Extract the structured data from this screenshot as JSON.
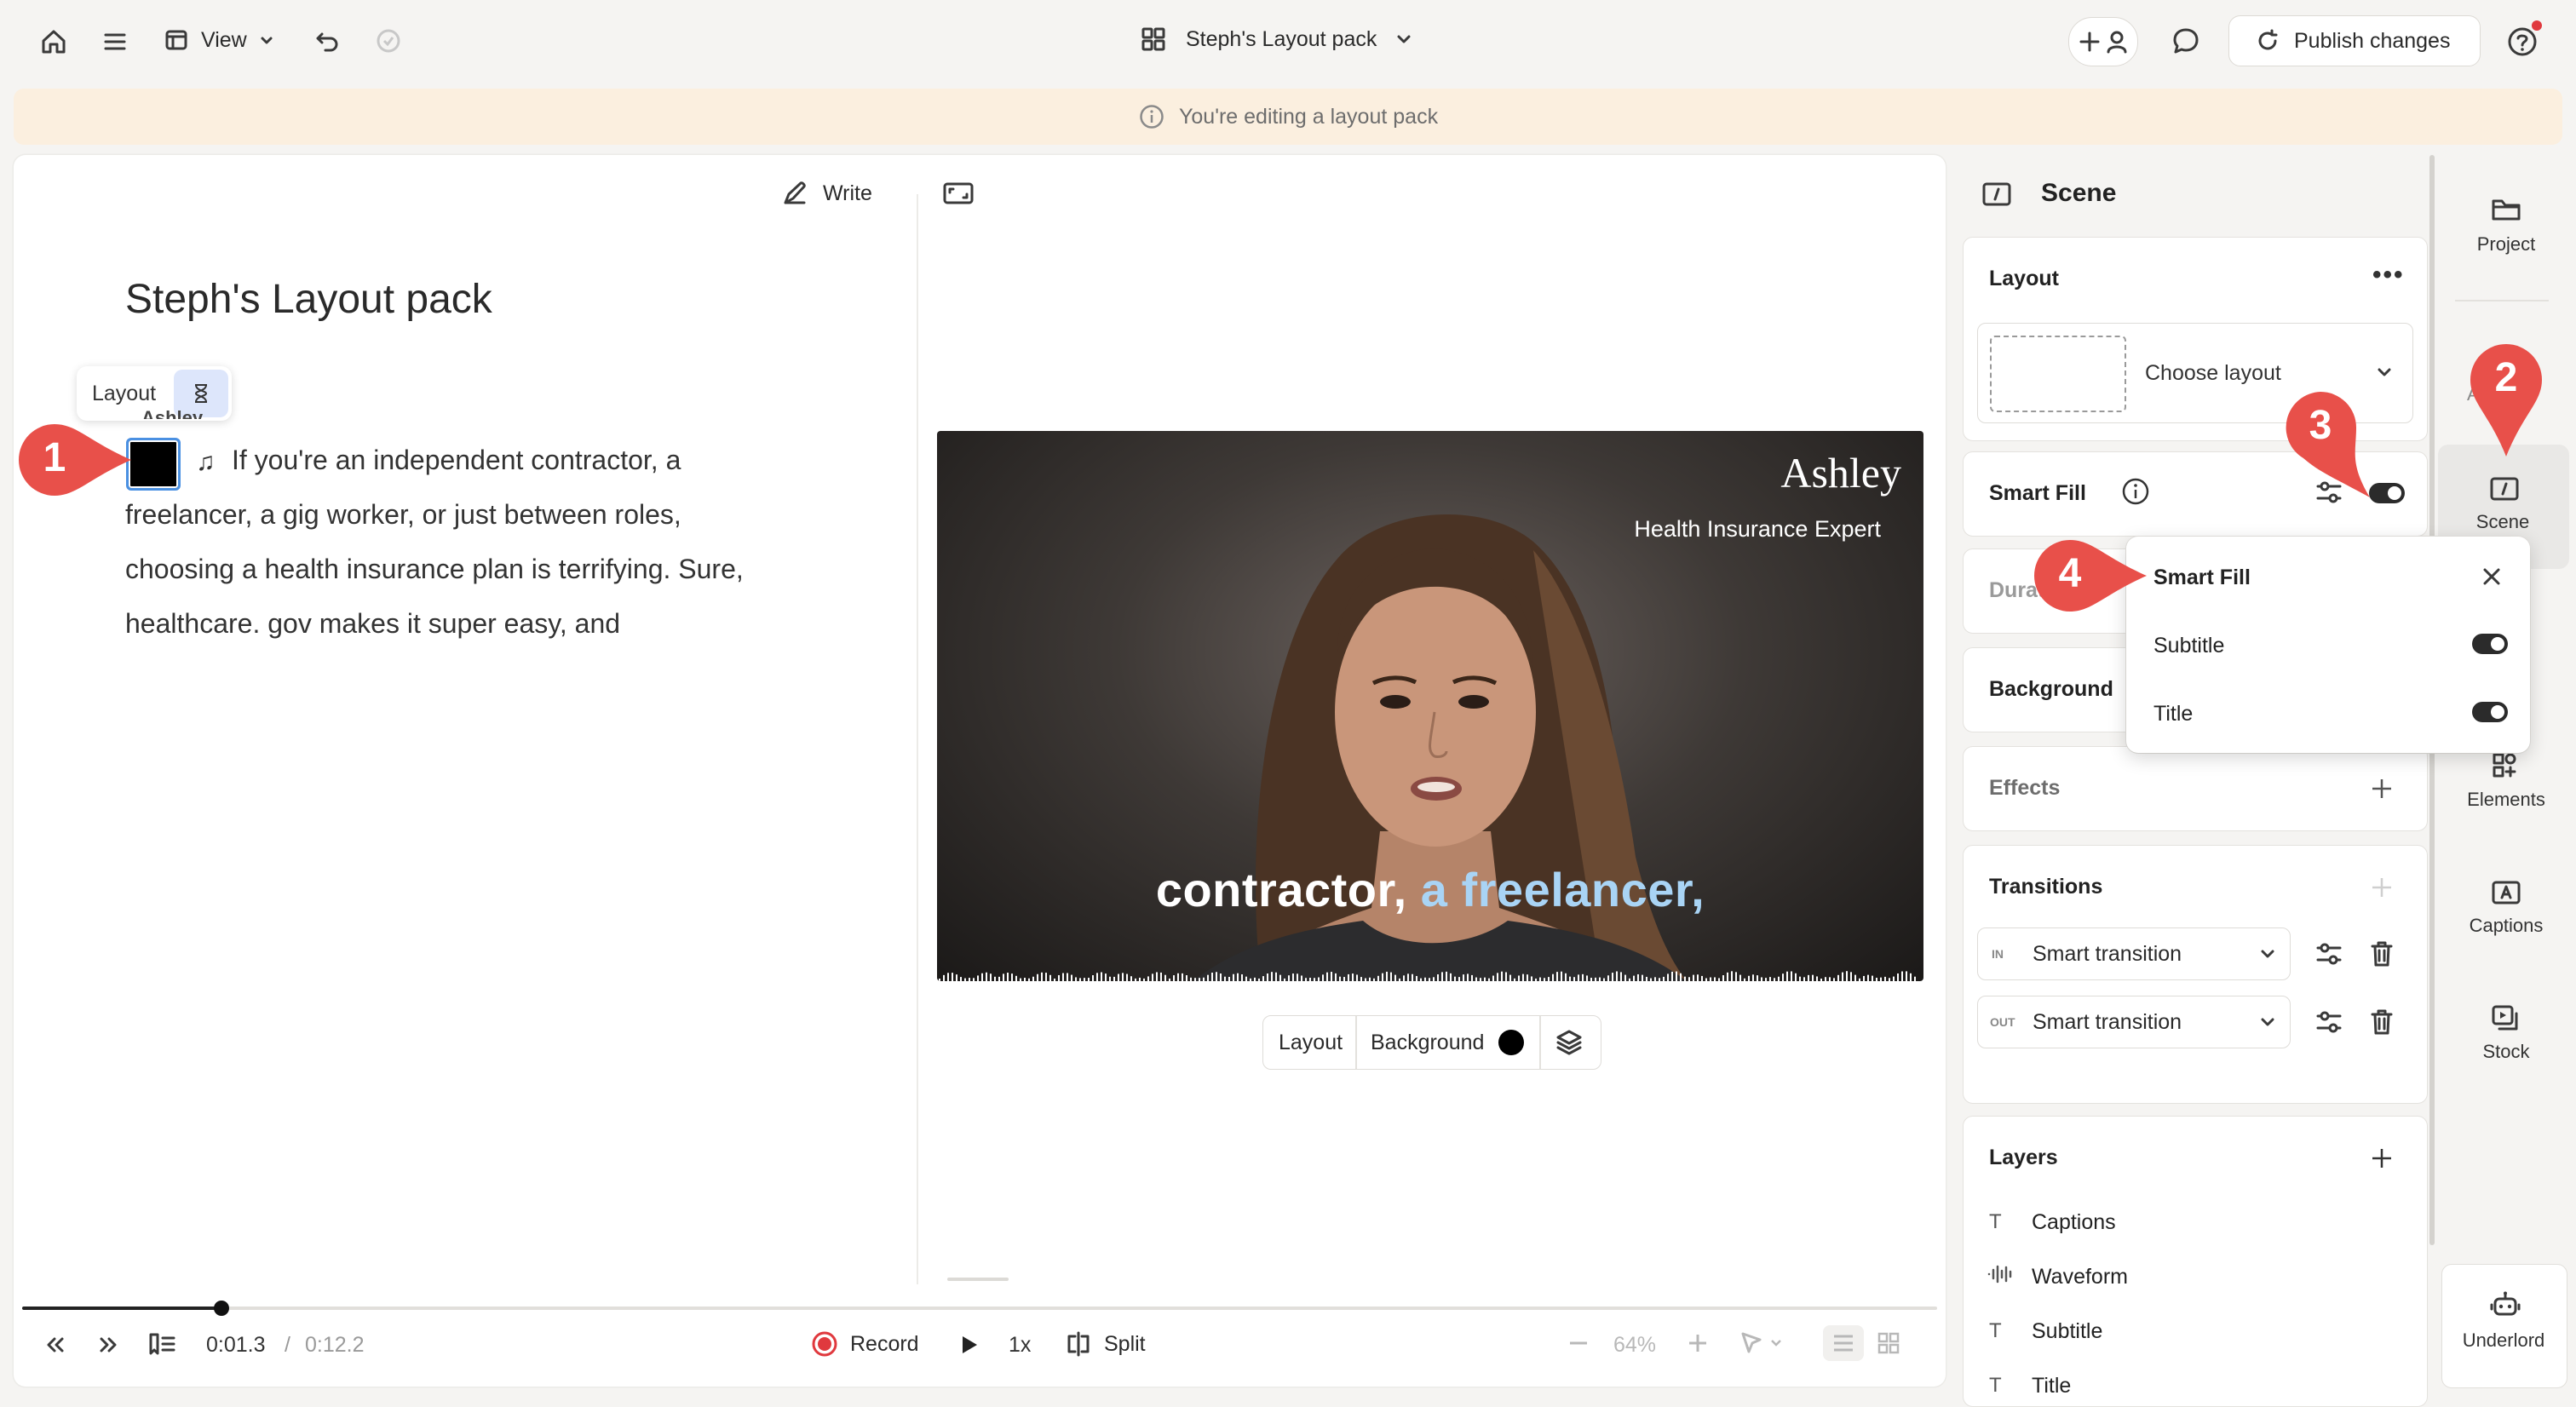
{
  "topbar": {
    "view_label": "View",
    "project_title": "Steph's Layout pack",
    "publish_label": "Publish changes"
  },
  "banner": {
    "text": "You're editing a layout pack"
  },
  "editor": {
    "write_label": "Write",
    "doc_title": "Steph's Layout pack",
    "layout_chip": "Layout",
    "speaker": "Ashley",
    "script_lines": [
      "If you're an independent contractor, a",
      "freelancer, a gig worker, or just between roles,",
      "choosing a health insurance plan is terrifying. Sure,",
      "healthcare. gov makes it super easy, and"
    ]
  },
  "preview": {
    "name": "Ashley",
    "role": "Health Insurance Expert",
    "caption_plain": "contractor,",
    "caption_highlight": "a freelancer,",
    "toolbar_layout": "Layout",
    "toolbar_background": "Background"
  },
  "transport": {
    "time_current": "0:01.3",
    "time_sep": "/",
    "time_total": "0:12.2",
    "record_label": "Record",
    "speed": "1x",
    "split_label": "Split",
    "zoom": "64%",
    "progress": 0.104
  },
  "inspector": {
    "title": "Scene",
    "layout_title": "Layout",
    "choose_layout": "Choose layout",
    "smart_fill": "Smart Fill",
    "duration_partial": "Durat",
    "background": "Background",
    "effects": "Effects",
    "transitions": "Transitions",
    "transition_in_tag": "IN",
    "transition_out_tag": "OUT",
    "transition_in": "Smart transition",
    "transition_out": "Smart transition",
    "layers_title": "Layers",
    "layers": [
      "Captions",
      "Waveform",
      "Subtitle",
      "Title"
    ]
  },
  "popover": {
    "title": "Smart Fill",
    "items": [
      {
        "label": "Subtitle",
        "on": true
      },
      {
        "label": "Title",
        "on": true
      }
    ]
  },
  "rail": {
    "items": [
      "Project",
      "Scene",
      "Elements",
      "Captions",
      "Stock"
    ],
    "bottom": "Underlord",
    "partial_a": "A"
  },
  "annotations": [
    "1",
    "2",
    "3",
    "4"
  ],
  "colors": {
    "accent": "#e8504a",
    "banner": "#fbefdf",
    "record": "#e0393e",
    "highlight": "#a9d4f5"
  }
}
